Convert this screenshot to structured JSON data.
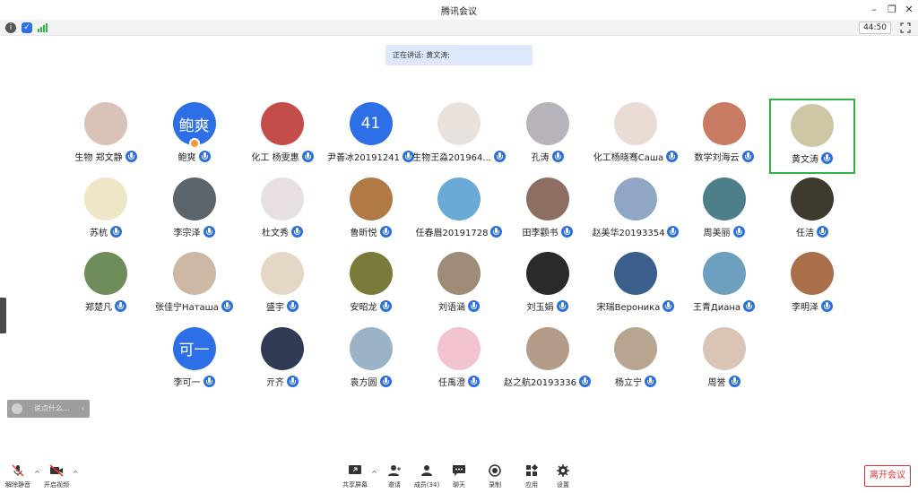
{
  "window": {
    "title": "腾讯会议"
  },
  "status": {
    "timer": "44:50"
  },
  "speaker": {
    "text": "正在讲话: 黄文涛;"
  },
  "participants": [
    {
      "name": "生物 郑文静",
      "avatar": "photo",
      "color": "#d8c3b6"
    },
    {
      "name": "鲍爽",
      "avatar": "text",
      "avatar_text": "鲍爽",
      "color": "#2d6fe6",
      "host": true
    },
    {
      "name": "化工 杨雯惠",
      "avatar": "photo",
      "color": "#c44d4a"
    },
    {
      "name": "尹善冰20191241",
      "avatar": "text",
      "avatar_text": "41",
      "color": "#2d6fe6"
    },
    {
      "name": "生物王淼201964...",
      "avatar": "photo",
      "color": "#e9e2dc"
    },
    {
      "name": "孔涛",
      "avatar": "photo",
      "color": "#b8b2ba"
    },
    {
      "name": "化工杨晓骞Саша",
      "avatar": "photo",
      "color": "#eadbd4"
    },
    {
      "name": "数学刘海云",
      "avatar": "photo",
      "color": "#c97a62"
    },
    {
      "name": "黄文涛",
      "avatar": "photo",
      "color": "#cfc6a6",
      "active": true
    },
    {
      "name": "苏杭",
      "avatar": "photo",
      "color": "#efe6c8"
    },
    {
      "name": "李宗泽",
      "avatar": "photo",
      "color": "#5c646c"
    },
    {
      "name": "杜文秀",
      "avatar": "photo",
      "color": "#e8dfe2"
    },
    {
      "name": "鲁昕悦",
      "avatar": "photo",
      "color": "#b07a47"
    },
    {
      "name": "任春眉20191728",
      "avatar": "photo",
      "color": "#6aaad6"
    },
    {
      "name": "田李颧书",
      "avatar": "photo",
      "color": "#8d6e63"
    },
    {
      "name": "赵美华20193354",
      "avatar": "photo",
      "color": "#8fa7c4"
    },
    {
      "name": "周美丽",
      "avatar": "photo",
      "color": "#4d7f8a"
    },
    {
      "name": "任洁",
      "avatar": "photo",
      "color": "#3f3a2f"
    },
    {
      "name": "郑楚凡",
      "avatar": "photo",
      "color": "#6f8d5a"
    },
    {
      "name": "张佳宁Наташа",
      "avatar": "photo",
      "color": "#cdb7a5"
    },
    {
      "name": "盛宇",
      "avatar": "photo",
      "color": "#e4d7c5"
    },
    {
      "name": "安昭龙",
      "avatar": "photo",
      "color": "#7a7b3a"
    },
    {
      "name": "刘语涵",
      "avatar": "photo",
      "color": "#9f8c76"
    },
    {
      "name": "刘玉娟",
      "avatar": "photo",
      "color": "#2a2a2a"
    },
    {
      "name": "宋瑞Вероника",
      "avatar": "photo",
      "color": "#3b5f8d"
    },
    {
      "name": "王青Диана",
      "avatar": "photo",
      "color": "#6d9fbf"
    },
    {
      "name": "李明泽",
      "avatar": "photo",
      "color": "#a86f48"
    },
    {
      "name": "李可一",
      "avatar": "text",
      "avatar_text": "可一",
      "color": "#2d6fe6"
    },
    {
      "name": "亓齐",
      "avatar": "photo",
      "color": "#2f3a55"
    },
    {
      "name": "袁方圆",
      "avatar": "photo",
      "color": "#9bb3c7"
    },
    {
      "name": "任禹澄",
      "avatar": "photo",
      "color": "#f1c4cf"
    },
    {
      "name": "赵之航20193336",
      "avatar": "photo",
      "color": "#b49b88"
    },
    {
      "name": "杨立宁",
      "avatar": "photo",
      "color": "#b8a58f"
    },
    {
      "name": "周誉",
      "avatar": "photo",
      "color": "#d9c4b5"
    }
  ],
  "chat": {
    "placeholder": "说点什么..."
  },
  "toolbar": {
    "unmute": "解除静音",
    "start_video": "开启视频",
    "share_screen": "共享屏幕",
    "invite": "邀请",
    "members": "成员(34)",
    "chat": "聊天",
    "record": "录制",
    "apps": "应用",
    "settings": "设置",
    "leave": "离开会议"
  }
}
